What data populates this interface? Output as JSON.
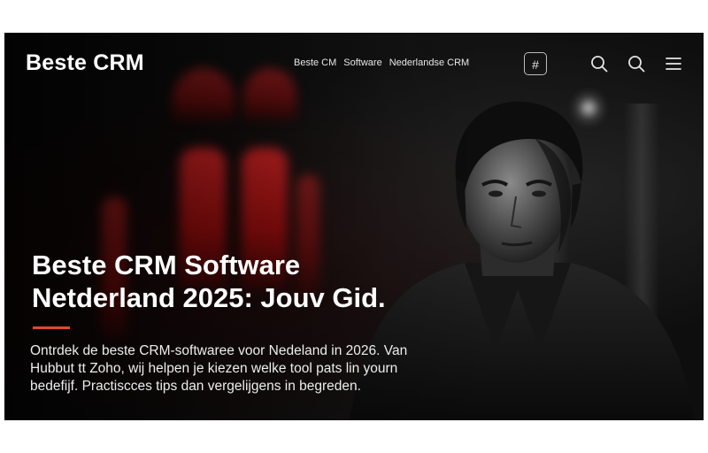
{
  "header": {
    "logo": "Beste CRM",
    "nav": {
      "items": [
        {
          "label": "Beste CM"
        },
        {
          "label": "Software"
        },
        {
          "label": "Nederlandse CRM"
        }
      ]
    },
    "hash_button": "#",
    "icons": [
      "search-icon",
      "search-icon",
      "menu-icon"
    ]
  },
  "hero": {
    "title": "Beste CRM Software Netderland 2025: Jouv Gid.",
    "description": "Ontrdek de beste CRM-softwaree voor Nedeland in 2026. Van Hubbut tt Zoho, wij helpen je kiezen welke tool pats lin yourn bedefijf. Practiscces tips dan vergelijgens in begreden.",
    "accent_color": "#e2472b"
  }
}
